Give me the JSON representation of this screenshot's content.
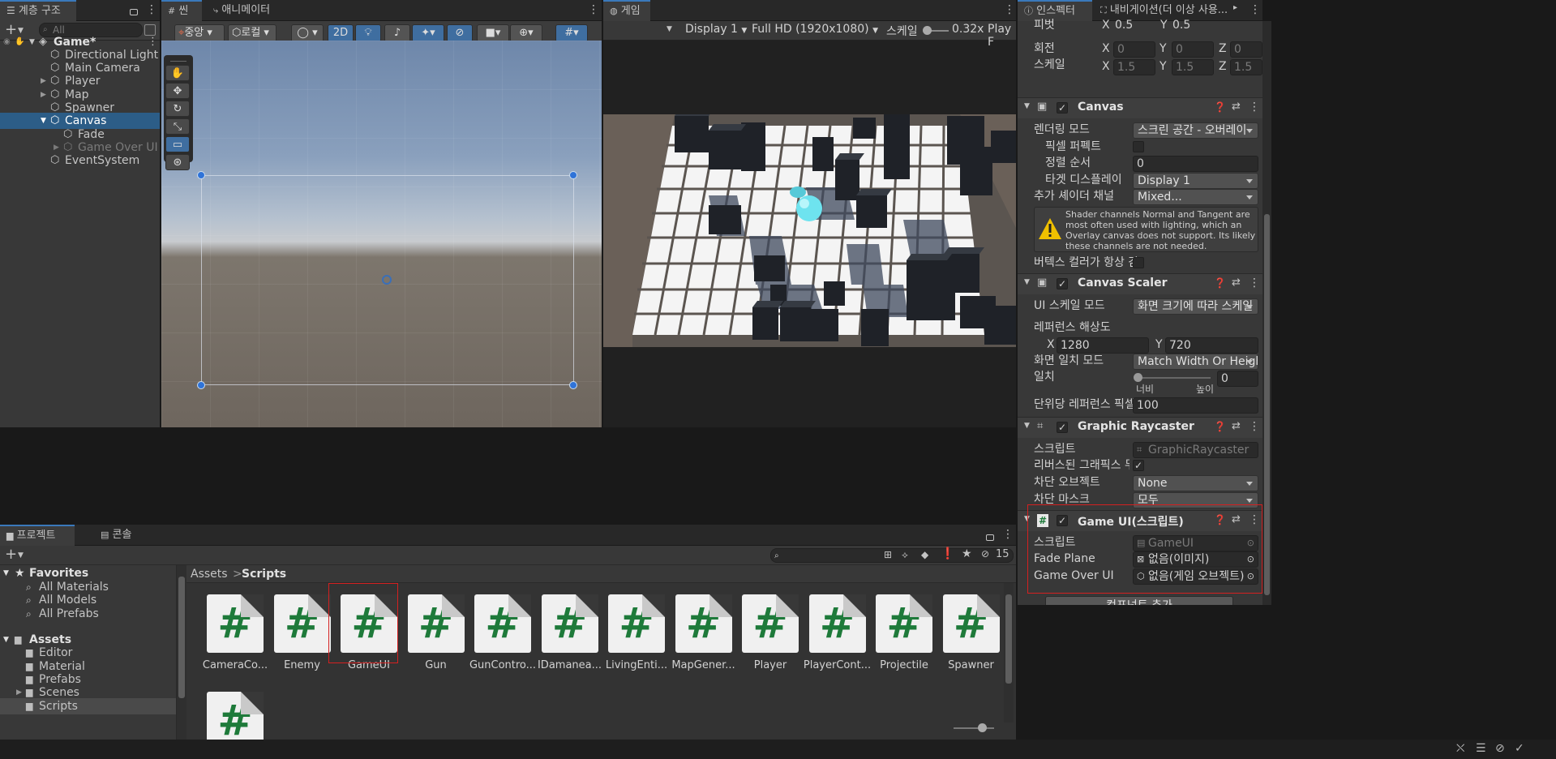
{
  "hierarchy": {
    "tab_label": "계층 구조",
    "search_placeholder": "All",
    "scene_name": "Game*",
    "items": [
      {
        "label": "Directional Light"
      },
      {
        "label": "Main Camera"
      },
      {
        "label": "Player"
      },
      {
        "label": "Map"
      },
      {
        "label": "Spawner"
      },
      {
        "label": "Canvas"
      },
      {
        "label": "Fade"
      },
      {
        "label": "Game Over UI"
      },
      {
        "label": "EventSystem"
      }
    ]
  },
  "scene": {
    "tab_label": "씬",
    "animator_tab_label": "애니메이터",
    "pivot_label": "중앙",
    "space_label": "로컬",
    "mode_2d_label": "2D"
  },
  "game": {
    "tab_label": "게임",
    "display_label": "Display 1",
    "resolution_label": "Full HD (1920x1080)",
    "scale_label": "스케일",
    "scale_value": "0.32x",
    "play_label": "Play F"
  },
  "inspector": {
    "tab_label": "인스펙터",
    "nav_tab_label": "내비게이션(더 이상 사용...",
    "pivot": {
      "label": "피벗",
      "x": "0.5",
      "y": "0.5"
    },
    "rotation": {
      "label": "회전",
      "x": "0",
      "y": "0",
      "z": "0"
    },
    "scale": {
      "label": "스케일",
      "x": "1.5",
      "y": "1.5",
      "z": "1.5"
    },
    "axis_x": "X",
    "axis_y": "Y",
    "axis_z": "Z",
    "canvas": {
      "title": "Canvas",
      "render_mode_label": "렌더링 모드",
      "render_mode_value": "스크린 공간 - 오버레이",
      "pixel_perfect_label": "픽셀 퍼펙트",
      "sort_order_label": "정렬 순서",
      "sort_order_value": "0",
      "target_display_label": "타겟 디스플레이",
      "target_display_value": "Display 1",
      "shader_channels_label": "추가 셰이더 채널",
      "shader_channels_value": "Mixed...",
      "warning_text": "Shader channels Normal and Tangent are most often used with lighting, which an Overlay canvas does not support. Its likely these channels are not needed.",
      "vertex_color_label": "버텍스 컬러가 항상 감"
    },
    "canvas_scaler": {
      "title": "Canvas Scaler",
      "ui_scale_mode_label": "UI 스케일 모드",
      "ui_scale_mode_value": "화면 크기에 따라 스케일",
      "ref_res_label": "레퍼런스 해상도",
      "ref_x": "1280",
      "ref_y": "720",
      "screen_match_label": "화면 일치 모드",
      "screen_match_value": "Match Width Or Heigh",
      "match_label": "일치",
      "match_value": "0",
      "match_min_label": "너비",
      "match_max_label": "높이",
      "match_level": 0,
      "ref_ppu_label": "단위당 레퍼런스 픽셀",
      "ref_ppu_value": "100"
    },
    "graphic_raycaster": {
      "title": "Graphic Raycaster",
      "script_label": "스크립트",
      "script_value": "GraphicRaycaster",
      "ignore_reversed_label": "리버스된 그래픽스 무시",
      "blocking_objects_label": "차단 오브젝트",
      "blocking_objects_value": "None",
      "blocking_mask_label": "차단 마스크",
      "blocking_mask_value": "모두"
    },
    "game_ui": {
      "title": "Game UI(스크립트)",
      "script_label": "스크립트",
      "script_value": "GameUI",
      "fade_plane_label": "Fade Plane",
      "fade_plane_value": "없음(이미지)",
      "game_over_label": "Game Over UI",
      "game_over_value": "없음(게임 오브젝트)"
    },
    "add_component_label": "컴포넌트 추가"
  },
  "project": {
    "tab_label": "프로젝트",
    "console_tab_label": "콘솔",
    "hidden_count": "15",
    "favorites_label": "Favorites",
    "favorites": [
      {
        "label": "All Materials"
      },
      {
        "label": "All Models"
      },
      {
        "label": "All Prefabs"
      }
    ],
    "assets_label": "Assets",
    "folders": [
      {
        "label": "Editor"
      },
      {
        "label": "Material"
      },
      {
        "label": "Prefabs"
      },
      {
        "label": "Scenes"
      },
      {
        "label": "Scripts"
      }
    ],
    "breadcrumb": {
      "root": "Assets",
      "sep": ">",
      "current": "Scripts"
    },
    "scripts": [
      {
        "label": "CameraCo..."
      },
      {
        "label": "Enemy"
      },
      {
        "label": "GameUI"
      },
      {
        "label": "Gun"
      },
      {
        "label": "GunContro..."
      },
      {
        "label": "IDamanea..."
      },
      {
        "label": "LivingEnti..."
      },
      {
        "label": "MapGener..."
      },
      {
        "label": "Player"
      },
      {
        "label": "PlayerCont..."
      },
      {
        "label": "Projectile"
      },
      {
        "label": "Spawner"
      }
    ]
  },
  "colors": {
    "selection": "#2c5d87",
    "highlight_box": "#d42020",
    "script_icon_green": "#1e7a3a"
  }
}
